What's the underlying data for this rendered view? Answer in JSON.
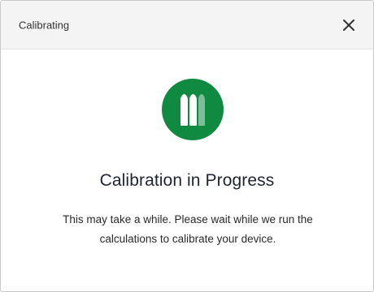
{
  "dialog": {
    "title": "Calibrating",
    "close_icon": "close-icon",
    "status_icon": "calibration-bars-icon",
    "heading": "Calibration in Progress",
    "message": "This may take a while. Please wait while we run the calculations to calibrate your device."
  },
  "colors": {
    "accent": "#118a41",
    "titlebar_bg": "#f4f4f4",
    "heading_text": "#1f2530"
  }
}
